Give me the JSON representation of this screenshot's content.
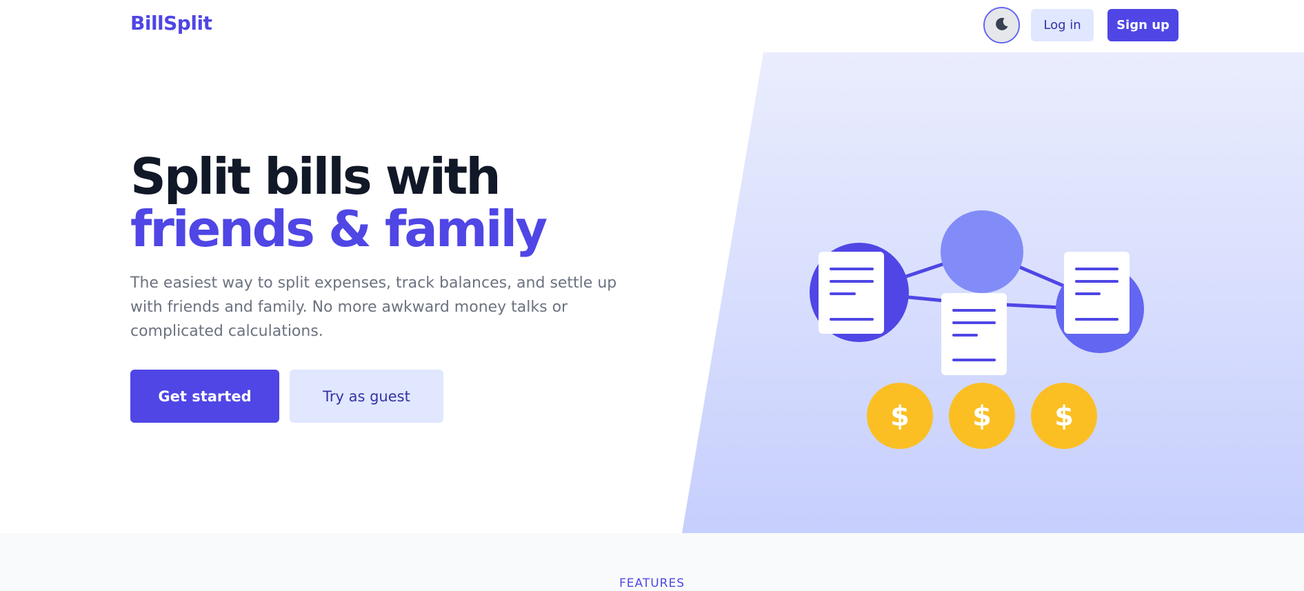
{
  "header": {
    "brand": "BillSplit",
    "theme_toggle_icon": "moon-icon",
    "login_label": "Log in",
    "signup_label": "Sign up"
  },
  "hero": {
    "title_line1": "Split bills with",
    "title_line2": "friends & family",
    "description": "The easiest way to split expenses, track balances, and settle up with friends and family. No more awkward money talks or complicated calculations.",
    "primary_cta": "Get started",
    "secondary_cta": "Try as guest"
  },
  "illustration": {
    "coin_symbol": "$"
  },
  "features": {
    "label": "FEATURES"
  },
  "colors": {
    "brand": "#4f46e5",
    "heading": "#111827",
    "body_text": "#6b7280",
    "secondary_button_bg": "#e0e7ff",
    "coin": "#fbbf24"
  }
}
